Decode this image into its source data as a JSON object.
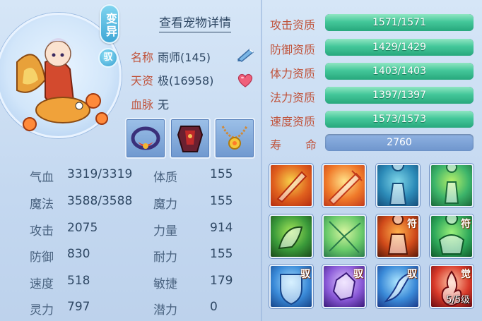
{
  "header": {
    "variant_badge": "变异",
    "tame_badge": "驭",
    "view_details_link": "查看宠物详情"
  },
  "info": {
    "name_label": "名称",
    "name_value": "雨师(145)",
    "talent_label": "天资",
    "talent_value": "极(16958)",
    "bloodline_label": "血脉",
    "bloodline_value": "无"
  },
  "stats": [
    {
      "label": "气血",
      "value": "3319/3319",
      "label2": "体质",
      "value2": "155"
    },
    {
      "label": "魔法",
      "value": "3588/3588",
      "label2": "魔力",
      "value2": "155"
    },
    {
      "label": "攻击",
      "value": "2075",
      "label2": "力量",
      "value2": "914"
    },
    {
      "label": "防御",
      "value": "830",
      "label2": "耐力",
      "value2": "155"
    },
    {
      "label": "速度",
      "value": "518",
      "label2": "敏捷",
      "value2": "179"
    },
    {
      "label": "灵力",
      "value": "797",
      "label2": "潜力",
      "value2": "0"
    }
  ],
  "aptitudes": [
    {
      "label": "攻击资质",
      "value": "1571/1571",
      "fill": 1.0
    },
    {
      "label": "防御资质",
      "value": "1429/1429",
      "fill": 1.0
    },
    {
      "label": "体力资质",
      "value": "1403/1403",
      "fill": 1.0
    },
    {
      "label": "法力资质",
      "value": "1397/1397",
      "fill": 1.0
    },
    {
      "label": "速度资质",
      "value": "1573/1573",
      "fill": 1.0
    }
  ],
  "life": {
    "label_a": "寿",
    "label_b": "命",
    "value": "2760"
  },
  "skills": [
    {
      "icon": "flaming-sword-icon"
    },
    {
      "icon": "strike-sword-icon"
    },
    {
      "icon": "shadow-figure-icon"
    },
    {
      "icon": "green-aura-figure-icon"
    },
    {
      "icon": "green-beast-icon"
    },
    {
      "icon": "green-burst-icon"
    },
    {
      "icon": "fire-warrior-icon",
      "tag": "符"
    },
    {
      "icon": "green-muscle-icon",
      "tag": "符"
    },
    {
      "icon": "shield-icon",
      "tag": "驭"
    },
    {
      "icon": "purple-crystal-icon",
      "tag": "驭"
    },
    {
      "icon": "dash-figure-icon",
      "tag": "驭"
    },
    {
      "icon": "red-flame-icon",
      "tag": "觉",
      "level": "5/5级"
    }
  ],
  "colors": {
    "label_red": "#c0533b",
    "text_dark": "#2f4864",
    "bar_green": "#3ec393",
    "bar_blue": "#7a9fd4"
  }
}
